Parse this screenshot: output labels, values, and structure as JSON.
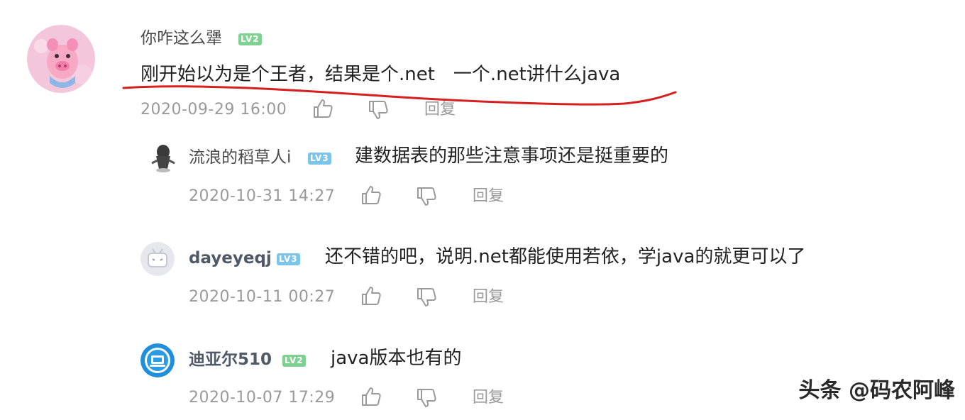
{
  "comments": [
    {
      "username": "你咋这么犟",
      "level": "LV2",
      "text": "刚开始以为是个王者，结果是个.net　一个.net讲什么java",
      "time": "2020-09-29 16:00",
      "reply_label": "回复"
    },
    {
      "username": "流浪的稻草人i",
      "level": "LV3",
      "text": "建数据表的那些注意事项还是挺重要的",
      "time": "2020-10-31 14:27",
      "reply_label": "回复"
    },
    {
      "username": "dayeyeqj",
      "level": "LV3",
      "text": "还不错的吧，说明.net都能使用若依，学java的就更可以了",
      "time": "2020-10-11 00:27",
      "reply_label": "回复"
    },
    {
      "username": "迪亚尔510",
      "level": "LV2",
      "text": "java版本也有的",
      "time": "2020-10-07 17:29",
      "reply_label": "回复"
    }
  ],
  "watermark": "头条 @码农阿峰",
  "colors": {
    "underline": "#d6201f",
    "level_green": "#7fd191",
    "level_blue": "#7cc4ea",
    "meta_gray": "#9a9a9a"
  },
  "icons": [
    "like-icon",
    "dislike-icon"
  ]
}
